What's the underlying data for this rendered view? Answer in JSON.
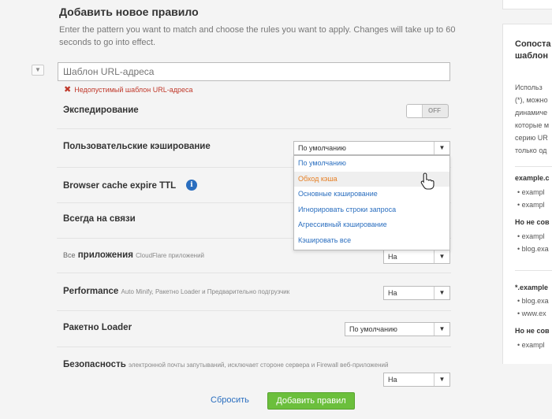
{
  "form": {
    "title": "Добавить новое правило",
    "description": "Enter the pattern you want to match and choose the rules you want to apply. Changes will take up to 60 seconds to go into effect.",
    "collapse_icon": "chevron-down-icon",
    "url_placeholder": "Шаблон URL-адреса",
    "error_text": "Недопустимый шаблон URL-адреса",
    "error_icon": "x-icon"
  },
  "rows": {
    "forwarding": {
      "label": "Экспедирование",
      "toggle": "OFF"
    },
    "custom_cache": {
      "label": "Пользовательские кэширование",
      "value": "По умолчанию"
    },
    "browser_ttl": {
      "label": "Browser cache expire TTL",
      "info_icon": "i"
    },
    "always_online": {
      "label": "Всегда на связи"
    },
    "apps": {
      "prefix": "Все",
      "label": "приложения",
      "sub": "CloudFlare приложений",
      "value": "На"
    },
    "performance": {
      "label": "Performance",
      "sub": "Auto Minify, Ракетно Loader и Предварительно подгрузчик",
      "value": "На"
    },
    "rocket_loader": {
      "label": "Ракетно Loader",
      "value": "По умолчанию"
    },
    "security": {
      "label": "Безопасность",
      "sub": "электронной почты запутываний, исключает стороне сервера и Firewall веб-приложений",
      "value": "На"
    }
  },
  "dropdown": {
    "options": [
      "По умолчанию",
      "Обход кэша",
      "Основные кэширование",
      "Игнорировать строки запроса",
      "Агрессивный кэширование",
      "Кэшировать все"
    ],
    "highlighted_index": 1
  },
  "actions": {
    "reset": "Сбросить",
    "apply": "Добавить правил"
  },
  "help": {
    "title_lines": [
      "Сопоста",
      "шаблон"
    ],
    "text_lines": [
      "Использ",
      "(*), можно",
      "динамиче",
      "которые м",
      "серию UR",
      "только од"
    ],
    "ex1_title": "example.c",
    "ex1_items": [
      "exampl",
      "exampl"
    ],
    "no_match1": "Но не сов",
    "no_match1_items": [
      "exampl",
      "blog.exa"
    ],
    "ex2_title": "*.example",
    "ex2_items": [
      "blog.exa",
      "www.ex"
    ],
    "no_match2": "Но не сов",
    "no_match2_items": [
      "exampl"
    ]
  },
  "colors": {
    "accent": "#2a6ebf",
    "apply": "#6bbf3c",
    "error": "#c0392b",
    "highlight": "#e67e22"
  }
}
